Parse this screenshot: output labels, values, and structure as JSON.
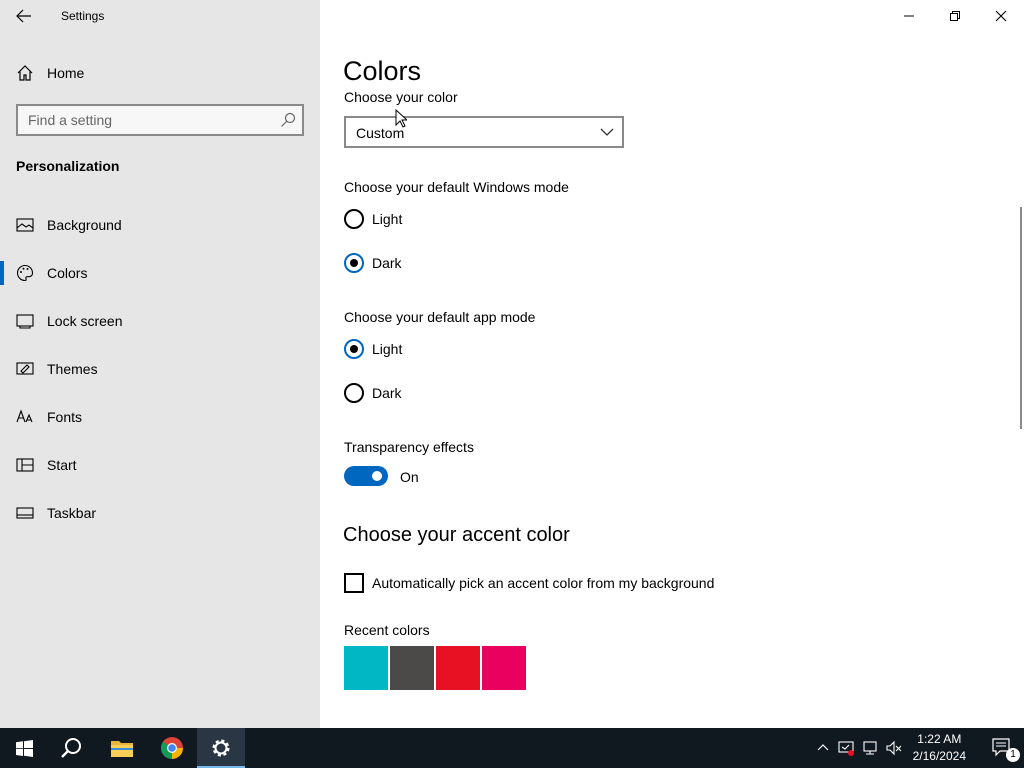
{
  "window": {
    "title": "Settings"
  },
  "sidebar": {
    "home_label": "Home",
    "search_placeholder": "Find a setting",
    "section": "Personalization",
    "items": [
      {
        "label": "Background",
        "icon": "picture-icon"
      },
      {
        "label": "Colors",
        "icon": "palette-icon",
        "active": true
      },
      {
        "label": "Lock screen",
        "icon": "lock-screen-icon"
      },
      {
        "label": "Themes",
        "icon": "brush-icon"
      },
      {
        "label": "Fonts",
        "icon": "font-icon"
      },
      {
        "label": "Start",
        "icon": "start-layout-icon"
      },
      {
        "label": "Taskbar",
        "icon": "taskbar-icon"
      }
    ]
  },
  "main": {
    "title": "Colors",
    "choose_color_label": "Choose your color",
    "choose_color_value": "Custom",
    "windows_mode_label": "Choose your default Windows mode",
    "windows_mode_options": [
      "Light",
      "Dark"
    ],
    "windows_mode_selected": "Dark",
    "app_mode_label": "Choose your default app mode",
    "app_mode_options": [
      "Light",
      "Dark"
    ],
    "app_mode_selected": "Light",
    "transparency_label": "Transparency effects",
    "transparency_state": "On",
    "accent_heading": "Choose your accent color",
    "auto_accent_label": "Automatically pick an accent color from my background",
    "recent_colors_label": "Recent colors",
    "recent_colors": [
      "#00b7c3",
      "#4c4a48",
      "#e81123",
      "#ea005e"
    ]
  },
  "taskbar": {
    "time": "1:22 AM",
    "date": "2/16/2024",
    "notification_count": "1"
  },
  "colors": {
    "accent": "#0067c0",
    "sidebar_bg": "#e6e6e6",
    "taskbar_bg": "#101820"
  }
}
